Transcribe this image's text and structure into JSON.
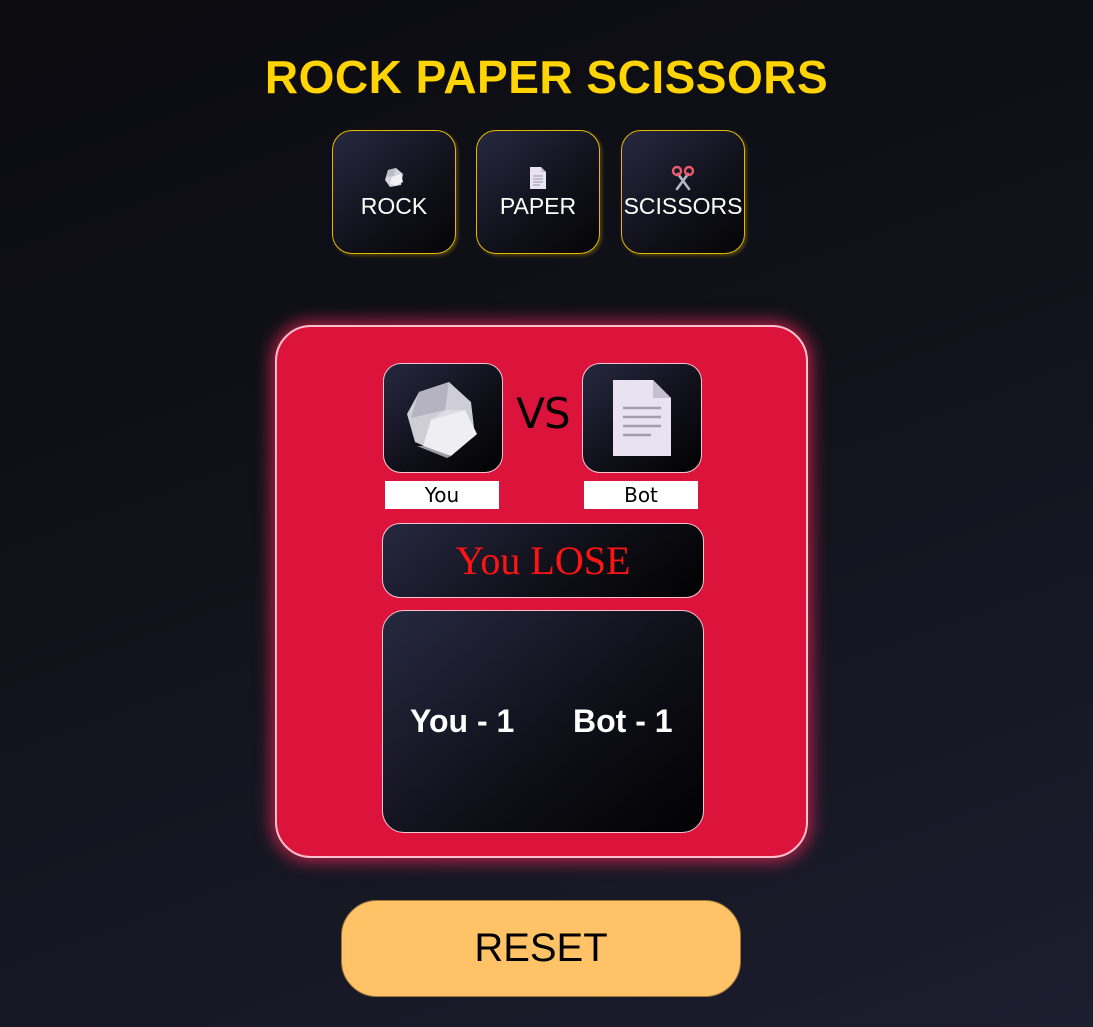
{
  "title": "ROCK PAPER SCISSORS",
  "choices": [
    {
      "label": "ROCK",
      "icon": "rock-icon"
    },
    {
      "label": "PAPER",
      "icon": "paper-icon"
    },
    {
      "label": "SCISSORS",
      "icon": "scissors-icon"
    }
  ],
  "result": {
    "you_pick_icon": "rock-icon",
    "bot_pick_icon": "paper-icon",
    "vs_text": "VS",
    "you_label": "You",
    "bot_label": "Bot",
    "outcome_text": "You LOSE"
  },
  "score": {
    "you_text": "You - 1",
    "bot_text": "Bot - 1"
  },
  "reset_label": "RESET",
  "colors": {
    "title": "#ffd400",
    "result_panel": "#dc143c",
    "outcome_text": "#ff1414",
    "reset_button": "#ffc266",
    "choice_border": "#e6b800"
  }
}
